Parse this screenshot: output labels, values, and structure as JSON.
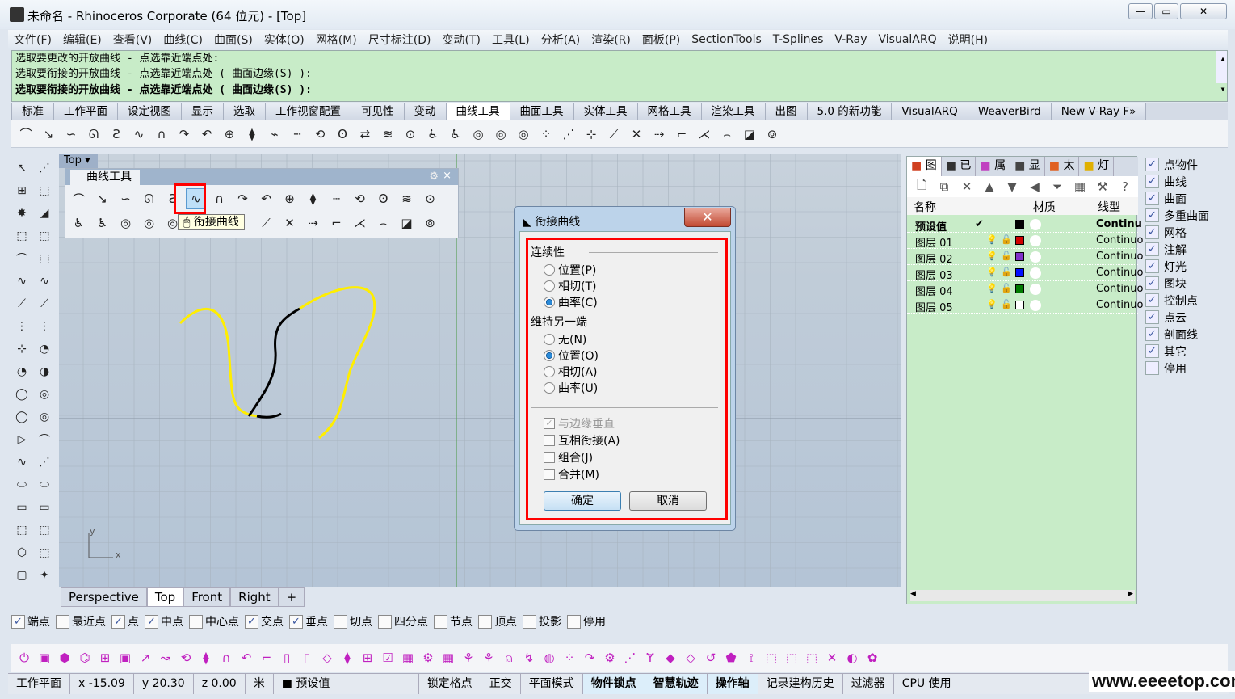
{
  "window": {
    "title": "未命名 - Rhinoceros Corporate (64 位元) - [Top]",
    "minimize": "—",
    "maximize": "▭",
    "close": "✕"
  },
  "menu": [
    "文件(F)",
    "编辑(E)",
    "查看(V)",
    "曲线(C)",
    "曲面(S)",
    "实体(O)",
    "网格(M)",
    "尺寸标注(D)",
    "变动(T)",
    "工具(L)",
    "分析(A)",
    "渲染(R)",
    "面板(P)",
    "SectionTools",
    "T-Splines",
    "V-Ray",
    "VisualARQ",
    "说明(H)"
  ],
  "command": {
    "history": [
      "选取要更改的开放曲线 - 点选靠近端点处:",
      "选取要衔接的开放曲线 - 点选靠近端点处 ( 曲面边缘(S) ):"
    ],
    "prompt": "选取要衔接的开放曲线 - 点选靠近端点处 ( 曲面边缘(S) ):"
  },
  "tabs": {
    "items": [
      "标准",
      "工作平面",
      "设定视图",
      "显示",
      "选取",
      "工作视窗配置",
      "可见性",
      "变动",
      "曲线工具",
      "曲面工具",
      "实体工具",
      "网格工具",
      "渲染工具",
      "出图",
      "5.0 的新功能",
      "VisualARQ",
      "WeaverBird",
      "New V-Ray F»"
    ],
    "active": "曲线工具"
  },
  "toolbar_icons": [
    "fillet-curves-icon",
    "chamfer-icon",
    "blend-curve-icon",
    "adjustable-blend-icon",
    "blend-icon",
    "match-curve-icon",
    "arc-blend-icon",
    "offset-curve-icon",
    "offset-normal-icon",
    "extend-icon",
    "project-icon",
    "pull-icon",
    "dash-icon",
    "circle-icon",
    "rebuild-icon",
    "fair-icon",
    "sweep-icon",
    "loft-icon",
    "edit-icon",
    "edit2-icon",
    "fit-icon",
    "deg-icon",
    "fair2-icon",
    "points-icon",
    "curve-points-icon",
    "insert-icon",
    "point-move-icon",
    "delete-point-icon",
    "insert-knot-icon",
    "kink-icon",
    "corner-icon",
    "arc-icon",
    "shape-icon",
    "cylinder-icon"
  ],
  "toolbar_glyphs": [
    "⌒",
    "↘",
    "∽",
    "ᘏ",
    "Ƨ",
    "∿",
    "∩",
    "↷",
    "↶",
    "⊕",
    "⧫",
    "⌁",
    "┄",
    "⟲",
    "ʘ",
    "⇄",
    "≋",
    "⊙",
    "♿",
    "♿",
    "◎",
    "◎",
    "◎",
    "⁘",
    "⋰",
    "⊹",
    "⟋",
    "✕",
    "⇢",
    "⌐",
    "⋌",
    "⌢",
    "◪",
    "⊚"
  ],
  "left_toolbar": [
    "↖",
    "⋰",
    "⊞",
    "⬚",
    "✸",
    "◢",
    "⬚",
    "⬚",
    "⌒",
    "⬚",
    "∿",
    "∿",
    "⟋",
    "⟋",
    "⋮",
    "⋮",
    "⊹",
    "◔",
    "◔",
    "◑",
    "◯",
    "◎",
    "◯",
    "◎",
    "▷",
    "⌒",
    "∿",
    "⋰",
    "⬭",
    "⬭",
    "▭",
    "▭",
    "⬚",
    "⬚",
    "⬡",
    "⬚",
    "▢",
    "✦"
  ],
  "viewport": {
    "label": "Top",
    "tabs": [
      "Perspective",
      "Top",
      "Front",
      "Right",
      "+"
    ],
    "active": "Top",
    "axis_x": "x",
    "axis_y": "y",
    "curve_colors": {
      "selected": "#ffee00",
      "adjusted": "#000000"
    }
  },
  "floating_toolbar": {
    "title": "曲线工具",
    "tooltip": "衔接曲线",
    "icons": [
      "⌒",
      "↘",
      "∽",
      "ᘏ",
      "Ƨ",
      "∿",
      "∩",
      "↷",
      "↶",
      "⊕",
      "⧫",
      "┄",
      "⟲",
      "ʘ",
      "≋",
      "⊙",
      "♿",
      "♿",
      "◎",
      "◎",
      "◎",
      "⁘",
      "",
      "",
      "⟋",
      "✕",
      "⇢",
      "⌐",
      "⋌",
      "⌢",
      "◪",
      "⊚"
    ],
    "close": "×",
    "gear": "⚙"
  },
  "dialog": {
    "title": "衔接曲线",
    "close": "✕",
    "continuity_label": "连续性",
    "continuity": [
      {
        "label": "位置(P)",
        "checked": false
      },
      {
        "label": "相切(T)",
        "checked": false
      },
      {
        "label": "曲率(C)",
        "checked": true
      }
    ],
    "preserve_label": "维持另一端",
    "preserve": [
      {
        "label": "无(N)",
        "checked": false
      },
      {
        "label": "位置(O)",
        "checked": true
      },
      {
        "label": "相切(A)",
        "checked": false
      },
      {
        "label": "曲率(U)",
        "checked": false
      }
    ],
    "checkboxes": [
      {
        "label": "与边缘垂直",
        "checked": true,
        "disabled": true
      },
      {
        "label": "互相衔接(A)",
        "checked": false
      },
      {
        "label": "组合(J)",
        "checked": false
      },
      {
        "label": "合并(M)",
        "checked": false
      }
    ],
    "ok": "确定",
    "cancel": "取消"
  },
  "panel": {
    "tabs": [
      "图",
      "已",
      "属",
      "显",
      "太",
      "灯"
    ],
    "columns": [
      "名称",
      "材质",
      "线型"
    ],
    "layers": [
      {
        "name": "预设值",
        "current": true,
        "check": "✔",
        "color": "#000000",
        "linetype": "Continu"
      },
      {
        "name": "图层 01",
        "color": "#d00000",
        "linetype": "Continuo"
      },
      {
        "name": "图层 02",
        "color": "#8030c8",
        "linetype": "Continuo"
      },
      {
        "name": "图层 03",
        "color": "#0010ff",
        "linetype": "Continuo"
      },
      {
        "name": "图层 04",
        "color": "#007a00",
        "linetype": "Continuo"
      },
      {
        "name": "图层 05",
        "color": "#ffffff",
        "linetype": "Continuo"
      }
    ],
    "toolbar": [
      "🗋",
      "⧉",
      "✕",
      "▲",
      "▼",
      "◀",
      "⏷",
      "▦",
      "⚒",
      "?"
    ]
  },
  "filters": [
    {
      "label": "点物件",
      "checked": true
    },
    {
      "label": "曲线",
      "checked": true
    },
    {
      "label": "曲面",
      "checked": true
    },
    {
      "label": "多重曲面",
      "checked": true
    },
    {
      "label": "网格",
      "checked": true
    },
    {
      "label": "注解",
      "checked": true
    },
    {
      "label": "灯光",
      "checked": true
    },
    {
      "label": "图块",
      "checked": true
    },
    {
      "label": "控制点",
      "checked": true
    },
    {
      "label": "点云",
      "checked": true
    },
    {
      "label": "剖面线",
      "checked": true
    },
    {
      "label": "其它",
      "checked": true
    },
    {
      "label": "停用",
      "checked": false
    }
  ],
  "osnap": [
    {
      "label": "端点",
      "checked": true
    },
    {
      "label": "最近点",
      "checked": false
    },
    {
      "label": "点",
      "checked": true
    },
    {
      "label": "中点",
      "checked": true
    },
    {
      "label": "中心点",
      "checked": false
    },
    {
      "label": "交点",
      "checked": true
    },
    {
      "label": "垂点",
      "checked": true
    },
    {
      "label": "切点",
      "checked": false
    },
    {
      "label": "四分点",
      "checked": false
    },
    {
      "label": "节点",
      "checked": false
    },
    {
      "label": "顶点",
      "checked": false
    },
    {
      "label": "投影",
      "checked": false
    },
    {
      "label": "停用",
      "checked": false
    }
  ],
  "status": {
    "cplane": "工作平面",
    "x": "x -15.09",
    "y": "y 20.30",
    "z": "z 0.00",
    "units": "米",
    "layer": "预设值",
    "toggles": [
      {
        "label": "锁定格点",
        "on": false
      },
      {
        "label": "正交",
        "on": false
      },
      {
        "label": "平面模式",
        "on": false
      },
      {
        "label": "物件锁点",
        "on": true
      },
      {
        "label": "智慧轨迹",
        "on": true
      },
      {
        "label": "操作轴",
        "on": true
      },
      {
        "label": "记录建构历史",
        "on": false
      },
      {
        "label": "过滤器",
        "on": false
      }
    ],
    "cpu": "CPU 使用"
  },
  "watermark": "www.eeeetop.com"
}
